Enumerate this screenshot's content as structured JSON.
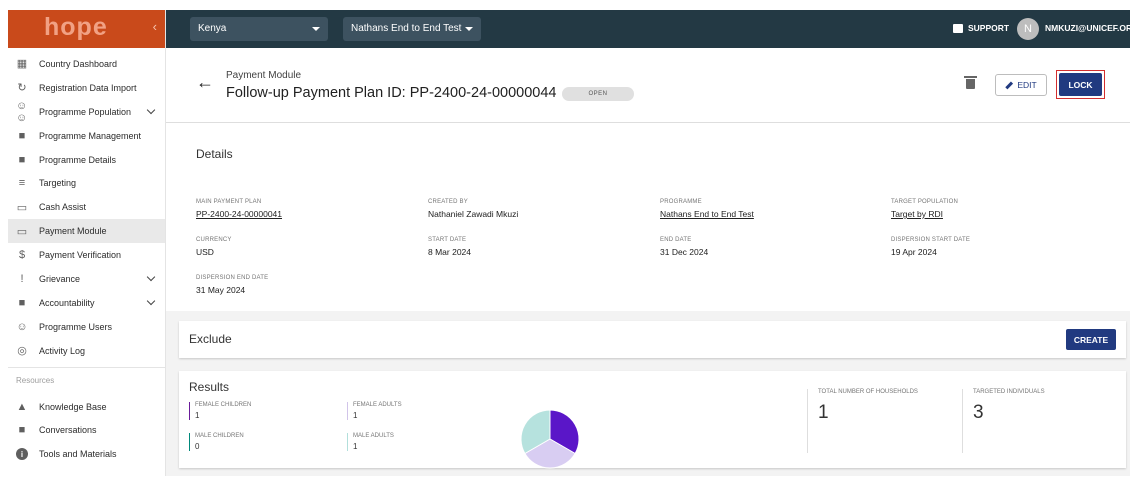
{
  "app": {
    "logo": "hope",
    "collapse_icon": "chevron-left-icon"
  },
  "topbar": {
    "country": "Kenya",
    "programme": "Nathans End to End Test",
    "support": "SUPPORT",
    "avatar_initial": "N",
    "user": "NMKUZI@UNICEF.OR"
  },
  "sidebar": {
    "items": [
      {
        "label": "Country Dashboard",
        "icon": "dashboard-icon"
      },
      {
        "label": "Registration Data Import",
        "icon": "refresh-icon"
      },
      {
        "label": "Programme Population",
        "icon": "people-icon",
        "expandable": true
      },
      {
        "label": "Programme Management",
        "icon": "clipboard-icon"
      },
      {
        "label": "Programme Details",
        "icon": "clipboard-icon"
      },
      {
        "label": "Targeting",
        "icon": "list-icon"
      },
      {
        "label": "Cash Assist",
        "icon": "card-icon"
      },
      {
        "label": "Payment Module",
        "icon": "card-icon",
        "active": true
      },
      {
        "label": "Payment Verification",
        "icon": "dollar-icon"
      },
      {
        "label": "Grievance",
        "icon": "feedback-icon",
        "expandable": true
      },
      {
        "label": "Accountability",
        "icon": "forum-icon",
        "expandable": true
      },
      {
        "label": "Programme Users",
        "icon": "users-icon"
      },
      {
        "label": "Activity Log",
        "icon": "radar-icon"
      }
    ],
    "resources_title": "Resources",
    "resources": [
      {
        "label": "Knowledge Base",
        "icon": "book-icon"
      },
      {
        "label": "Conversations",
        "icon": "forum-icon"
      },
      {
        "label": "Tools and Materials",
        "icon": "info-icon"
      }
    ]
  },
  "header": {
    "breadcrumb": "Payment Module",
    "title": "Follow-up Payment Plan ID: PP-2400-24-00000044",
    "status": "OPEN",
    "edit_label": "EDIT",
    "lock_label": "LOCK"
  },
  "details": {
    "title": "Details",
    "fields": [
      {
        "label": "MAIN PAYMENT PLAN",
        "value": "PP-2400-24-00000041",
        "link": true
      },
      {
        "label": "CREATED BY",
        "value": "Nathaniel Zawadi Mkuzi"
      },
      {
        "label": "PROGRAMME",
        "value": "Nathans End to End Test",
        "link": true
      },
      {
        "label": "TARGET POPULATION",
        "value": "Target by RDI",
        "link": true
      },
      {
        "label": "CURRENCY",
        "value": "USD"
      },
      {
        "label": "START DATE",
        "value": "8 Mar 2024"
      },
      {
        "label": "END DATE",
        "value": "31 Dec 2024"
      },
      {
        "label": "DISPERSION START DATE",
        "value": "19 Apr 2024"
      },
      {
        "label": "DISPERSION END DATE",
        "value": "31 May 2024"
      }
    ]
  },
  "exclude": {
    "title": "Exclude",
    "create_label": "CREATE"
  },
  "results": {
    "title": "Results",
    "stats": [
      {
        "label": "FEMALE CHILDREN",
        "value": "1",
        "color": "#6a1b9a"
      },
      {
        "label": "FEMALE ADULTS",
        "value": "1",
        "color": "#d1c4e9"
      },
      {
        "label": "MALE CHILDREN",
        "value": "0",
        "color": "#00897b"
      },
      {
        "label": "MALE ADULTS",
        "value": "1",
        "color": "#b2dfdb"
      }
    ],
    "total_households_label": "TOTAL NUMBER OF HOUSEHOLDS",
    "total_households": "1",
    "targeted_individuals_label": "TARGETED INDIVIDUALS",
    "targeted_individuals": "3"
  },
  "chart_data": {
    "type": "pie",
    "categories": [
      "Female Children",
      "Female Adults",
      "Male Children",
      "Male Adults"
    ],
    "values": [
      1,
      1,
      0,
      1
    ],
    "colors": [
      "#5a16c8",
      "#d8cdf2",
      "#00897b",
      "#b6e2de"
    ]
  }
}
